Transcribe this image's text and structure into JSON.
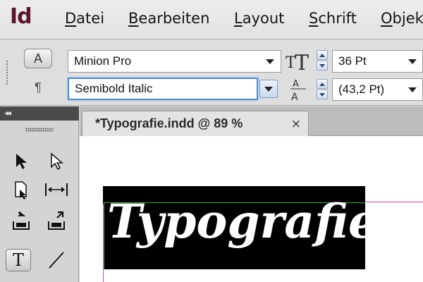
{
  "app": {
    "logo": "Id"
  },
  "menu": {
    "items": [
      {
        "first": "D",
        "rest": "atei"
      },
      {
        "first": "B",
        "rest": "earbeiten"
      },
      {
        "first": "L",
        "rest": "ayout"
      },
      {
        "first": "S",
        "rest": "chrift"
      },
      {
        "first": "O",
        "rest": "bjek"
      }
    ]
  },
  "control_panel": {
    "char_mode_label": "A",
    "para_mode_label": "¶",
    "font_family": "Minion Pro",
    "font_style": "Semibold Italic",
    "font_size": "36 Pt",
    "leading": "(43,2 Pt)",
    "icons": [
      "font-size-icon",
      "leading-icon",
      "spinner-icon",
      "dropdown-arrow-icon"
    ]
  },
  "tools_panel": {
    "collapse_label": "◂◂",
    "type_tool_label": "T",
    "icons": [
      "selection-tool-icon",
      "direct-selection-tool-icon",
      "page-tool-icon",
      "gap-tool-icon",
      "content-collector-icon",
      "content-placer-icon",
      "type-tool-icon",
      "line-tool-icon"
    ]
  },
  "document": {
    "tab_title": "*Typografie.indd @ 89 %",
    "close_label": "×",
    "headline": "Typografie"
  },
  "colors": {
    "frame_fill": "#000000",
    "text_color": "#ffffff",
    "frame_edge": "#3fae3f",
    "guide": "#c050c8",
    "logo": "#5a1530"
  }
}
